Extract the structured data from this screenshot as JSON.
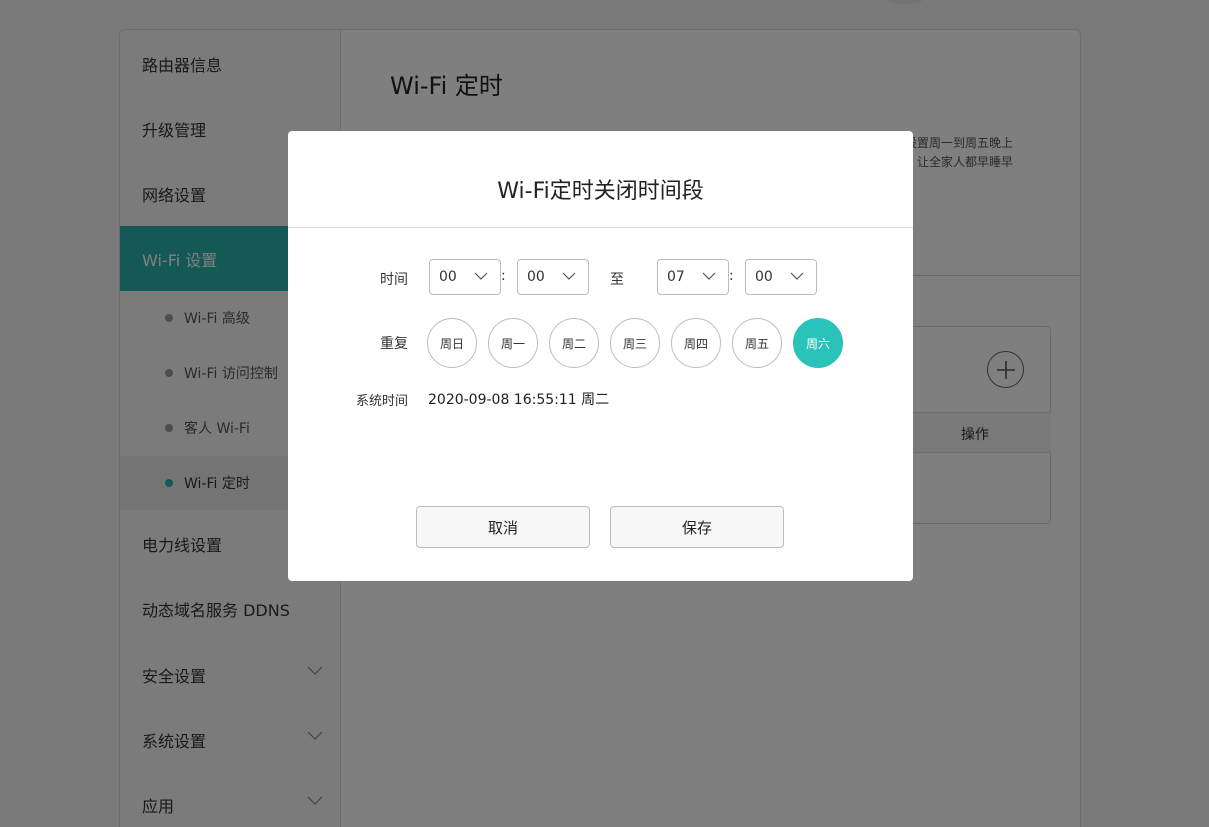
{
  "sidebar": {
    "items": [
      {
        "label": "路由器信息"
      },
      {
        "label": "升级管理"
      },
      {
        "label": "网络设置"
      },
      {
        "label": "Wi-Fi 设置"
      },
      {
        "label": "电力线设置"
      },
      {
        "label": "动态域名服务 DDNS"
      },
      {
        "label": "安全设置"
      },
      {
        "label": "系统设置"
      },
      {
        "label": "应用"
      }
    ],
    "subitems": [
      {
        "label": "Wi-Fi 高级"
      },
      {
        "label": "Wi-Fi 访问控制"
      },
      {
        "label": "客人 Wi-Fi"
      },
      {
        "label": "Wi-Fi 定时"
      }
    ]
  },
  "main": {
    "title": "Wi-Fi 定时",
    "desc_line1": "设置周一到周五晚上",
    "desc_line2": "，让全家人都早睡早",
    "table_op_header": "操作"
  },
  "dialog": {
    "title": "Wi-Fi定时关闭时间段",
    "time_label": "时间",
    "start_hour": "00",
    "start_minute": "00",
    "to_label": "至",
    "end_hour": "07",
    "end_minute": "00",
    "colon": ":",
    "repeat_label": "重复",
    "days": [
      "周日",
      "周一",
      "周二",
      "周三",
      "周四",
      "周五",
      "周六"
    ],
    "selected_days": [
      "周六"
    ],
    "system_time_label": "系统时间",
    "system_time": "2020-09-08 16:55:11 周二",
    "cancel_label": "取消",
    "save_label": "保存"
  },
  "colors": {
    "accent": "#2bb3ac",
    "day_selected": "#2bc2ba",
    "overlay": "rgba(0,0,0,0.5)"
  }
}
